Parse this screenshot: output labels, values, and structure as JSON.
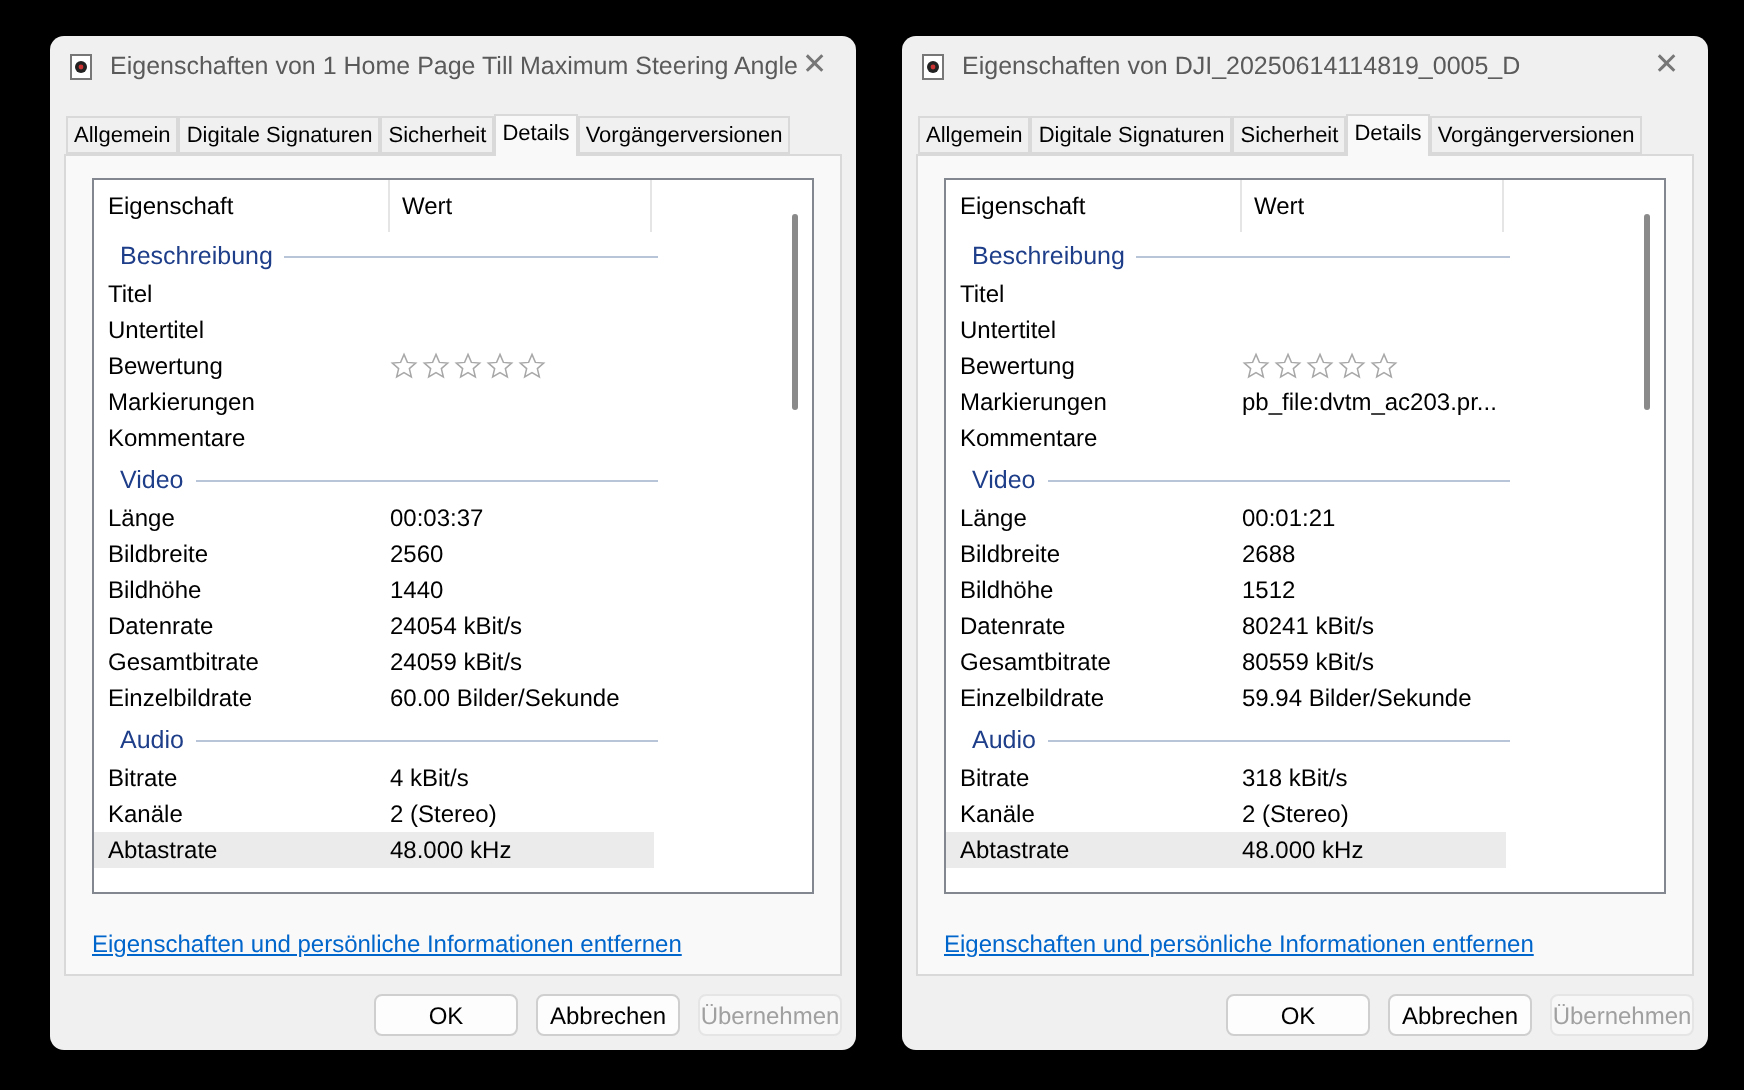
{
  "windows": [
    {
      "title": "Eigenschaften von 1 Home Page Till Maximum Steering Angle",
      "close": "✕",
      "tabs": [
        {
          "label": "Allgemein",
          "selected": false
        },
        {
          "label": "Digitale Signaturen",
          "selected": false
        },
        {
          "label": "Sicherheit",
          "selected": false
        },
        {
          "label": "Details",
          "selected": true
        },
        {
          "label": "Vorgängerversionen",
          "selected": false
        }
      ],
      "columns": [
        "Eigenschaft",
        "Wert"
      ],
      "groups": [
        {
          "title": "Beschreibung",
          "rows": [
            {
              "kind": "text",
              "property": "Titel",
              "selected": false
            },
            {
              "kind": "text",
              "property": "Untertitel",
              "selected": false
            },
            {
              "kind": "rating",
              "property": "Bewertung",
              "stars": 0,
              "selected": false
            },
            {
              "kind": "text",
              "property": "Markierungen",
              "selected": false
            },
            {
              "kind": "text",
              "property": "Kommentare",
              "selected": false
            }
          ]
        },
        {
          "title": "Video",
          "rows": [
            {
              "kind": "text",
              "property": "Länge",
              "value": "00:03:37",
              "selected": false
            },
            {
              "kind": "text",
              "property": "Bildbreite",
              "value": "2560",
              "selected": false
            },
            {
              "kind": "text",
              "property": "Bildhöhe",
              "value": "1440",
              "selected": false
            },
            {
              "kind": "text",
              "property": "Datenrate",
              "value": "24054 kBit/s",
              "selected": false
            },
            {
              "kind": "text",
              "property": "Gesamtbitrate",
              "value": "24059 kBit/s",
              "selected": false
            },
            {
              "kind": "text",
              "property": "Einzelbildrate",
              "value": "60.00 Bilder/Sekunde",
              "selected": false
            }
          ]
        },
        {
          "title": "Audio",
          "rows": [
            {
              "kind": "text",
              "property": "Bitrate",
              "value": "4 kBit/s",
              "selected": false
            },
            {
              "kind": "text",
              "property": "Kanäle",
              "value": "2 (Stereo)",
              "selected": false
            },
            {
              "kind": "text",
              "property": "Abtastrate",
              "value": "48.000 kHz",
              "selected": true
            }
          ]
        }
      ],
      "link": "Eigenschaften und persönliche Informationen entfernen",
      "buttons": [
        {
          "label": "OK",
          "disabled": false
        },
        {
          "label": "Abbrechen",
          "disabled": false
        },
        {
          "label": "Übernehmen",
          "disabled": true
        }
      ]
    },
    {
      "title": "Eigenschaften von DJI_20250614114819_0005_D",
      "close": "✕",
      "tabs": [
        {
          "label": "Allgemein",
          "selected": false
        },
        {
          "label": "Digitale Signaturen",
          "selected": false
        },
        {
          "label": "Sicherheit",
          "selected": false
        },
        {
          "label": "Details",
          "selected": true
        },
        {
          "label": "Vorgängerversionen",
          "selected": false
        }
      ],
      "columns": [
        "Eigenschaft",
        "Wert"
      ],
      "groups": [
        {
          "title": "Beschreibung",
          "rows": [
            {
              "kind": "text",
              "property": "Titel",
              "selected": false
            },
            {
              "kind": "text",
              "property": "Untertitel",
              "selected": false
            },
            {
              "kind": "rating",
              "property": "Bewertung",
              "stars": 0,
              "selected": false
            },
            {
              "kind": "text",
              "property": "Markierungen",
              "value": "pb_file:dvtm_ac203.pr...",
              "selected": false
            },
            {
              "kind": "text",
              "property": "Kommentare",
              "selected": false
            }
          ]
        },
        {
          "title": "Video",
          "rows": [
            {
              "kind": "text",
              "property": "Länge",
              "value": "00:01:21",
              "selected": false
            },
            {
              "kind": "text",
              "property": "Bildbreite",
              "value": "2688",
              "selected": false
            },
            {
              "kind": "text",
              "property": "Bildhöhe",
              "value": "1512",
              "selected": false
            },
            {
              "kind": "text",
              "property": "Datenrate",
              "value": "80241 kBit/s",
              "selected": false
            },
            {
              "kind": "text",
              "property": "Gesamtbitrate",
              "value": "80559 kBit/s",
              "selected": false
            },
            {
              "kind": "text",
              "property": "Einzelbildrate",
              "value": "59.94 Bilder/Sekunde",
              "selected": false
            }
          ]
        },
        {
          "title": "Audio",
          "rows": [
            {
              "kind": "text",
              "property": "Bitrate",
              "value": "318 kBit/s",
              "selected": false
            },
            {
              "kind": "text",
              "property": "Kanäle",
              "value": "2 (Stereo)",
              "selected": false
            },
            {
              "kind": "text",
              "property": "Abtastrate",
              "value": "48.000 kHz",
              "selected": true
            }
          ]
        }
      ],
      "link": "Eigenschaften und persönliche Informationen entfernen",
      "buttons": [
        {
          "label": "OK",
          "disabled": false
        },
        {
          "label": "Abbrechen",
          "disabled": false
        },
        {
          "label": "Übernehmen",
          "disabled": true
        }
      ]
    }
  ]
}
